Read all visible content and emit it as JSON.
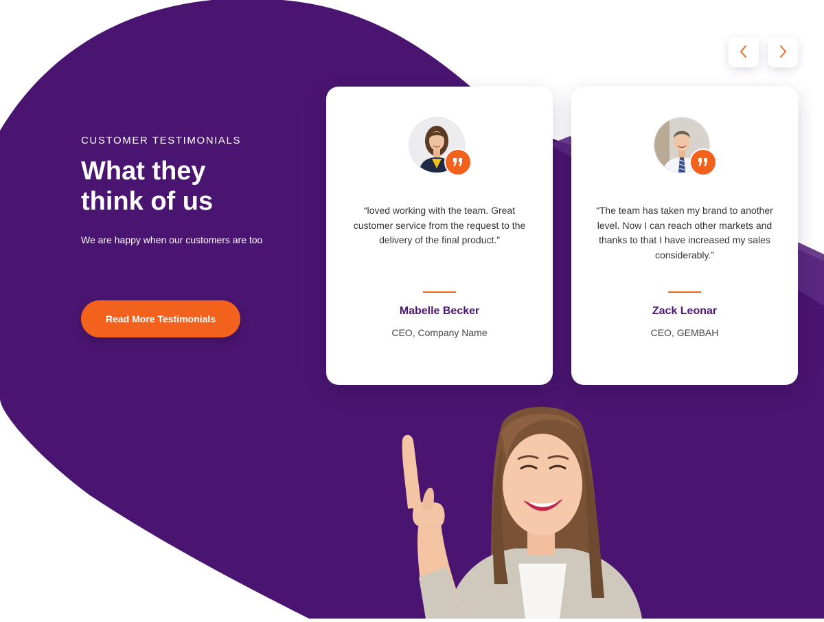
{
  "colors": {
    "brand_purple": "#4a1570",
    "accent_orange": "#f2621c",
    "card_background": "#ffffff",
    "page_background": "#ffffff"
  },
  "intro": {
    "eyebrow": "CUSTOMER TESTIMONIALS",
    "headline": "What they\nthink of us",
    "subtitle": "We are happy when our customers are too",
    "cta_label": "Read More Testimonials"
  },
  "navigation": {
    "prev_icon": "chevron-left-icon",
    "next_icon": "chevron-right-icon"
  },
  "testimonials": [
    {
      "quote": "“loved working with the team. Great customer service from the request to the delivery of the final product.”",
      "name": "Mabelle Becker",
      "role": "CEO, Company Name",
      "avatar_icon": "woman-avatar-icon",
      "badge_icon": "quote-icon"
    },
    {
      "quote": "“The team has taken my brand to another level. Now I can reach other markets and thanks to that I have increased my sales considerably.”",
      "name": "Zack Leonar",
      "role": "CEO, GEMBAH",
      "avatar_icon": "man-avatar-icon",
      "badge_icon": "quote-icon"
    }
  ],
  "hero_image": "smiling-woman-pointing-up"
}
